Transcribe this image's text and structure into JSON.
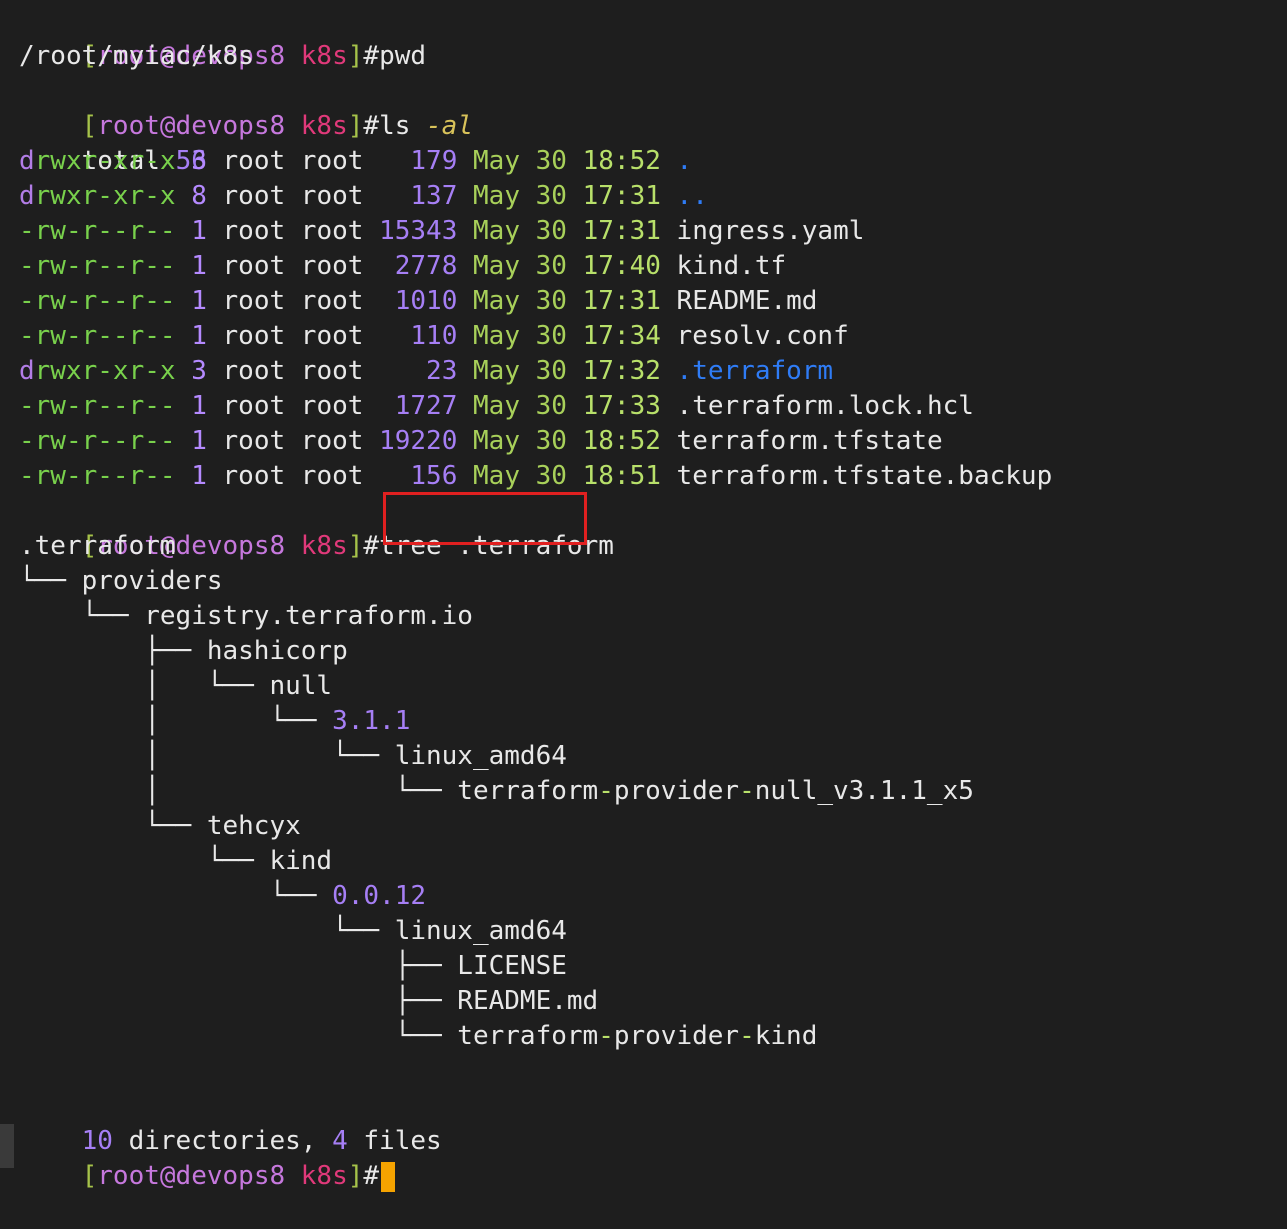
{
  "prompt": {
    "open": "[",
    "user": "root@devops8",
    "sep": " ",
    "dir": "k8s",
    "close": "]",
    "hash": "#"
  },
  "cmd_pwd": "pwd",
  "pwd_output": "/root/myiac/k8s",
  "cmd_ls": "ls",
  "cmd_ls_flag": "-al",
  "total_label": "total",
  "total_value": "56",
  "ls_rows": [
    {
      "perm_head": "d",
      "perm": "rwxr-xr-x",
      "links": "3",
      "owner": "root",
      "group": "root",
      "size": "179",
      "month": "May",
      "day": "30",
      "time": "18:52",
      "name": ".",
      "type": "dir"
    },
    {
      "perm_head": "d",
      "perm": "rwxr-xr-x",
      "links": "8",
      "owner": "root",
      "group": "root",
      "size": "137",
      "month": "May",
      "day": "30",
      "time": "17:31",
      "name": "..",
      "type": "dir"
    },
    {
      "perm_head": "-",
      "perm": "rw-r--r--",
      "links": "1",
      "owner": "root",
      "group": "root",
      "size": "15343",
      "month": "May",
      "day": "30",
      "time": "17:31",
      "name": "ingress.yaml",
      "type": "file"
    },
    {
      "perm_head": "-",
      "perm": "rw-r--r--",
      "links": "1",
      "owner": "root",
      "group": "root",
      "size": "2778",
      "month": "May",
      "day": "30",
      "time": "17:40",
      "name": "kind.tf",
      "type": "file"
    },
    {
      "perm_head": "-",
      "perm": "rw-r--r--",
      "links": "1",
      "owner": "root",
      "group": "root",
      "size": "1010",
      "month": "May",
      "day": "30",
      "time": "17:31",
      "name": "README.md",
      "type": "file"
    },
    {
      "perm_head": "-",
      "perm": "rw-r--r--",
      "links": "1",
      "owner": "root",
      "group": "root",
      "size": "110",
      "month": "May",
      "day": "30",
      "time": "17:34",
      "name": "resolv.conf",
      "type": "file"
    },
    {
      "perm_head": "d",
      "perm": "rwxr-xr-x",
      "links": "3",
      "owner": "root",
      "group": "root",
      "size": "23",
      "month": "May",
      "day": "30",
      "time": "17:32",
      "name": ".terraform",
      "type": "dir"
    },
    {
      "perm_head": "-",
      "perm": "rw-r--r--",
      "links": "1",
      "owner": "root",
      "group": "root",
      "size": "1727",
      "month": "May",
      "day": "30",
      "time": "17:33",
      "name": ".terraform.lock.hcl",
      "type": "file"
    },
    {
      "perm_head": "-",
      "perm": "rw-r--r--",
      "links": "1",
      "owner": "root",
      "group": "root",
      "size": "19220",
      "month": "May",
      "day": "30",
      "time": "18:52",
      "name": "terraform.tfstate",
      "type": "file"
    },
    {
      "perm_head": "-",
      "perm": "rw-r--r--",
      "links": "1",
      "owner": "root",
      "group": "root",
      "size": "156",
      "month": "May",
      "day": "30",
      "time": "18:51",
      "name": "terraform.tfstate.backup",
      "type": "file"
    }
  ],
  "cmd_tree": "tree",
  "cmd_tree_arg": " .terraform",
  "tree_lines": [
    {
      "prefix": "",
      "name": ".terraform",
      "kind": "plain"
    },
    {
      "prefix": "└── ",
      "name": "providers",
      "kind": "plain"
    },
    {
      "prefix": "    └── ",
      "name": "registry.terraform.io",
      "kind": "plain"
    },
    {
      "prefix": "        ├── ",
      "name": "hashicorp",
      "kind": "plain"
    },
    {
      "prefix": "        │   └── ",
      "name": "null",
      "kind": "plain"
    },
    {
      "prefix": "        │       └── ",
      "name": "3.1.1",
      "kind": "version"
    },
    {
      "prefix": "        │           └── ",
      "name": "linux_amd64",
      "kind": "plain"
    },
    {
      "prefix": "        │               └── ",
      "name": "terraform-provider-null_v3.1.1_x5",
      "kind": "exec"
    },
    {
      "prefix": "        └── ",
      "name": "tehcyx",
      "kind": "plain"
    },
    {
      "prefix": "            └── ",
      "name": "kind",
      "kind": "plain"
    },
    {
      "prefix": "                └── ",
      "name": "0.0.12",
      "kind": "version"
    },
    {
      "prefix": "                    └── ",
      "name": "linux_amd64",
      "kind": "plain"
    },
    {
      "prefix": "                        ├── ",
      "name": "LICENSE",
      "kind": "plain"
    },
    {
      "prefix": "                        ├── ",
      "name": "README.md",
      "kind": "plain"
    },
    {
      "prefix": "                        └── ",
      "name": "terraform-provider-kind",
      "kind": "exec"
    }
  ],
  "summary": {
    "dirs_count": "10",
    "dirs_label": " directories, ",
    "files_count": "4",
    "files_label": " files"
  },
  "colors": {
    "background": "#1e1e1e",
    "highlight_box": "#e02020",
    "cursor": "#f5a300"
  }
}
